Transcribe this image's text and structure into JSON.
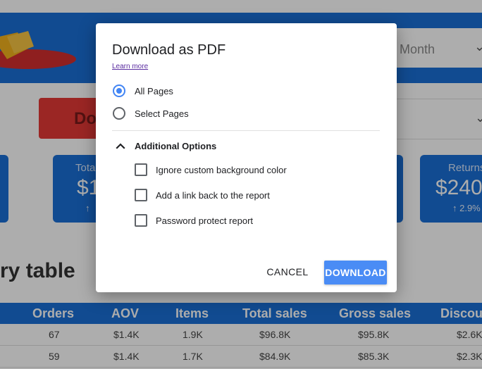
{
  "background": {
    "month_select": {
      "value": "Month",
      "chevron": "⌄"
    },
    "second_select": {
      "chevron": "⌄"
    },
    "red_button_partial": "Do",
    "kpis": [
      {
        "label": "Tota",
        "value": "$1",
        "delta": "↑"
      },
      {
        "label": "Returns",
        "value": "$240",
        "delta": "↑ 2.9%"
      }
    ],
    "table_title": "ry table",
    "table": {
      "columns": [
        "Orders",
        "AOV",
        "Items",
        "Total sales",
        "Gross sales",
        "Discou"
      ],
      "rows": [
        [
          "67",
          "$1.4K",
          "1.9K",
          "$96.8K",
          "$95.8K",
          "$2.6K"
        ],
        [
          "59",
          "$1.4K",
          "1.7K",
          "$84.9K",
          "$85.3K",
          "$2.3K"
        ]
      ]
    }
  },
  "dialog": {
    "title": "Download as PDF",
    "learn_more": "Learn more",
    "page_options": [
      {
        "label": "All Pages",
        "checked": true
      },
      {
        "label": "Select Pages",
        "checked": false
      }
    ],
    "additional_options": {
      "label": "Additional Options",
      "expanded": true,
      "icon": "chevron-up-icon",
      "options": [
        {
          "label": "Ignore custom background color",
          "checked": false
        },
        {
          "label": "Add a link back to the report",
          "checked": false
        },
        {
          "label": "Password protect report",
          "checked": false
        }
      ]
    },
    "cancel_label": "CANCEL",
    "download_label": "DOWNLOAD"
  },
  "colors": {
    "report_blue": "#1a6fd6",
    "primary_button": "#4a8cf5",
    "radio_selected": "#4285f4"
  }
}
